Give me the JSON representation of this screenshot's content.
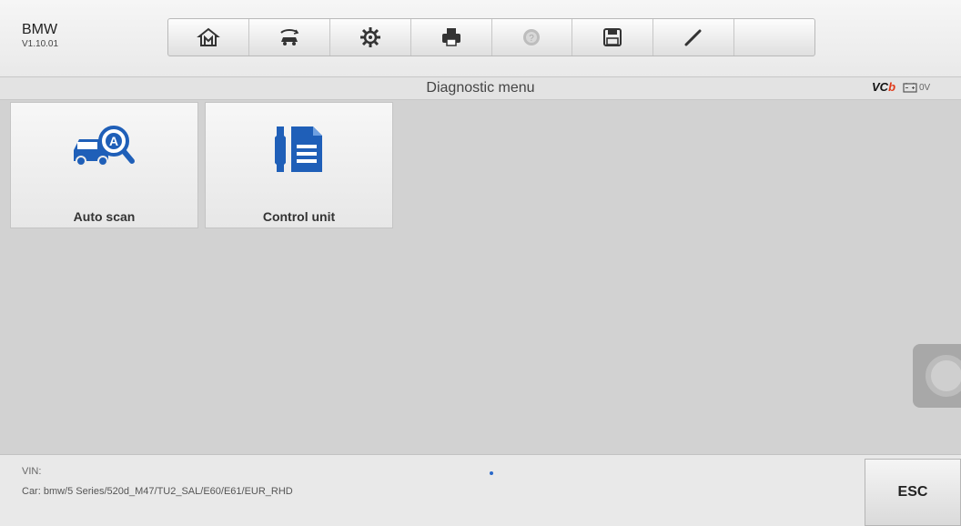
{
  "header": {
    "app_name": "BMW",
    "version": "V1.10.01"
  },
  "toolbar": {
    "buttons": [
      {
        "name": "home-icon"
      },
      {
        "name": "vehicle-swap-icon"
      },
      {
        "name": "settings-icon"
      },
      {
        "name": "print-icon"
      },
      {
        "name": "help-icon"
      },
      {
        "name": "save-icon"
      },
      {
        "name": "edit-icon"
      }
    ]
  },
  "title_bar": {
    "title": "Diagnostic menu",
    "vci_prefix": "VC",
    "vci_suffix": "b",
    "voltage": "0V"
  },
  "menu": {
    "tiles": [
      {
        "label": "Auto scan",
        "icon": "auto-scan-icon"
      },
      {
        "label": "Control unit",
        "icon": "control-unit-icon"
      }
    ]
  },
  "footer": {
    "vin": "VIN:",
    "car": "Car: bmw/5 Series/520d_M47/TU2_SAL/E60/E61/EUR_RHD",
    "esc_label": "ESC"
  },
  "colors": {
    "accent_blue": "#2a69c9",
    "vci_red": "#e03a1a"
  }
}
